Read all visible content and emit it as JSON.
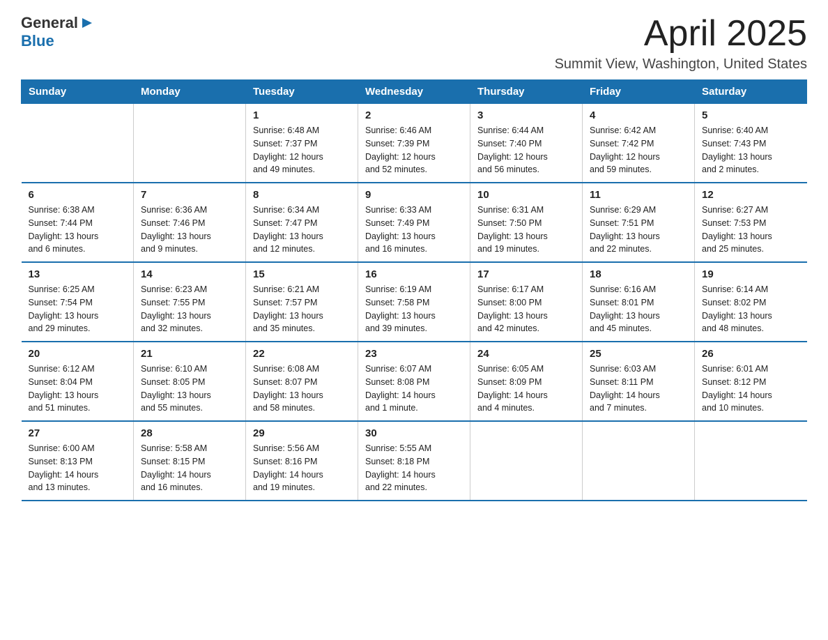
{
  "logo": {
    "text_general": "General",
    "text_blue": "Blue",
    "triangle_char": "▶"
  },
  "title": {
    "month": "April 2025",
    "location": "Summit View, Washington, United States"
  },
  "weekdays": [
    "Sunday",
    "Monday",
    "Tuesday",
    "Wednesday",
    "Thursday",
    "Friday",
    "Saturday"
  ],
  "rows": [
    [
      {
        "day": "",
        "info": ""
      },
      {
        "day": "",
        "info": ""
      },
      {
        "day": "1",
        "info": "Sunrise: 6:48 AM\nSunset: 7:37 PM\nDaylight: 12 hours\nand 49 minutes."
      },
      {
        "day": "2",
        "info": "Sunrise: 6:46 AM\nSunset: 7:39 PM\nDaylight: 12 hours\nand 52 minutes."
      },
      {
        "day": "3",
        "info": "Sunrise: 6:44 AM\nSunset: 7:40 PM\nDaylight: 12 hours\nand 56 minutes."
      },
      {
        "day": "4",
        "info": "Sunrise: 6:42 AM\nSunset: 7:42 PM\nDaylight: 12 hours\nand 59 minutes."
      },
      {
        "day": "5",
        "info": "Sunrise: 6:40 AM\nSunset: 7:43 PM\nDaylight: 13 hours\nand 2 minutes."
      }
    ],
    [
      {
        "day": "6",
        "info": "Sunrise: 6:38 AM\nSunset: 7:44 PM\nDaylight: 13 hours\nand 6 minutes."
      },
      {
        "day": "7",
        "info": "Sunrise: 6:36 AM\nSunset: 7:46 PM\nDaylight: 13 hours\nand 9 minutes."
      },
      {
        "day": "8",
        "info": "Sunrise: 6:34 AM\nSunset: 7:47 PM\nDaylight: 13 hours\nand 12 minutes."
      },
      {
        "day": "9",
        "info": "Sunrise: 6:33 AM\nSunset: 7:49 PM\nDaylight: 13 hours\nand 16 minutes."
      },
      {
        "day": "10",
        "info": "Sunrise: 6:31 AM\nSunset: 7:50 PM\nDaylight: 13 hours\nand 19 minutes."
      },
      {
        "day": "11",
        "info": "Sunrise: 6:29 AM\nSunset: 7:51 PM\nDaylight: 13 hours\nand 22 minutes."
      },
      {
        "day": "12",
        "info": "Sunrise: 6:27 AM\nSunset: 7:53 PM\nDaylight: 13 hours\nand 25 minutes."
      }
    ],
    [
      {
        "day": "13",
        "info": "Sunrise: 6:25 AM\nSunset: 7:54 PM\nDaylight: 13 hours\nand 29 minutes."
      },
      {
        "day": "14",
        "info": "Sunrise: 6:23 AM\nSunset: 7:55 PM\nDaylight: 13 hours\nand 32 minutes."
      },
      {
        "day": "15",
        "info": "Sunrise: 6:21 AM\nSunset: 7:57 PM\nDaylight: 13 hours\nand 35 minutes."
      },
      {
        "day": "16",
        "info": "Sunrise: 6:19 AM\nSunset: 7:58 PM\nDaylight: 13 hours\nand 39 minutes."
      },
      {
        "day": "17",
        "info": "Sunrise: 6:17 AM\nSunset: 8:00 PM\nDaylight: 13 hours\nand 42 minutes."
      },
      {
        "day": "18",
        "info": "Sunrise: 6:16 AM\nSunset: 8:01 PM\nDaylight: 13 hours\nand 45 minutes."
      },
      {
        "day": "19",
        "info": "Sunrise: 6:14 AM\nSunset: 8:02 PM\nDaylight: 13 hours\nand 48 minutes."
      }
    ],
    [
      {
        "day": "20",
        "info": "Sunrise: 6:12 AM\nSunset: 8:04 PM\nDaylight: 13 hours\nand 51 minutes."
      },
      {
        "day": "21",
        "info": "Sunrise: 6:10 AM\nSunset: 8:05 PM\nDaylight: 13 hours\nand 55 minutes."
      },
      {
        "day": "22",
        "info": "Sunrise: 6:08 AM\nSunset: 8:07 PM\nDaylight: 13 hours\nand 58 minutes."
      },
      {
        "day": "23",
        "info": "Sunrise: 6:07 AM\nSunset: 8:08 PM\nDaylight: 14 hours\nand 1 minute."
      },
      {
        "day": "24",
        "info": "Sunrise: 6:05 AM\nSunset: 8:09 PM\nDaylight: 14 hours\nand 4 minutes."
      },
      {
        "day": "25",
        "info": "Sunrise: 6:03 AM\nSunset: 8:11 PM\nDaylight: 14 hours\nand 7 minutes."
      },
      {
        "day": "26",
        "info": "Sunrise: 6:01 AM\nSunset: 8:12 PM\nDaylight: 14 hours\nand 10 minutes."
      }
    ],
    [
      {
        "day": "27",
        "info": "Sunrise: 6:00 AM\nSunset: 8:13 PM\nDaylight: 14 hours\nand 13 minutes."
      },
      {
        "day": "28",
        "info": "Sunrise: 5:58 AM\nSunset: 8:15 PM\nDaylight: 14 hours\nand 16 minutes."
      },
      {
        "day": "29",
        "info": "Sunrise: 5:56 AM\nSunset: 8:16 PM\nDaylight: 14 hours\nand 19 minutes."
      },
      {
        "day": "30",
        "info": "Sunrise: 5:55 AM\nSunset: 8:18 PM\nDaylight: 14 hours\nand 22 minutes."
      },
      {
        "day": "",
        "info": ""
      },
      {
        "day": "",
        "info": ""
      },
      {
        "day": "",
        "info": ""
      }
    ]
  ]
}
